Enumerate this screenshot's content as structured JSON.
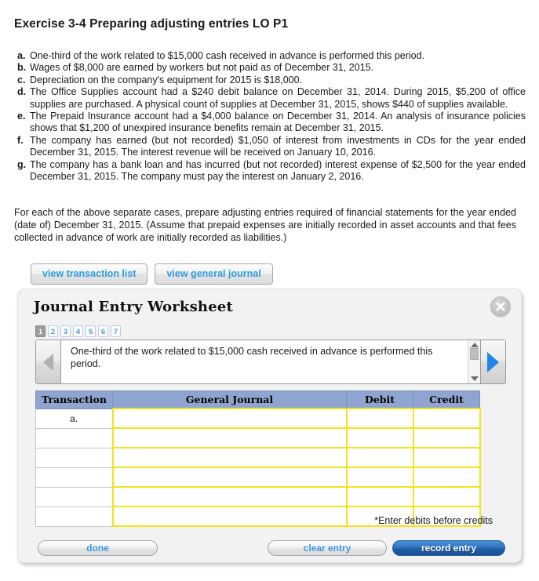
{
  "exercise": {
    "title": "Exercise 3-4 Preparing adjusting entries LO P1"
  },
  "problems": [
    {
      "letter": "a.",
      "text": "One-third of the work related to $15,000 cash received in advance is performed this period."
    },
    {
      "letter": "b.",
      "text": "Wages of $8,000 are earned by workers but not paid as of December 31, 2015."
    },
    {
      "letter": "c.",
      "text": "Depreciation on the company's equipment for 2015 is $18,000."
    },
    {
      "letter": "d.",
      "text": "The Office Supplies account had a $240 debit balance on December 31, 2014. During 2015, $5,200 of office supplies are purchased. A physical count of supplies at December 31, 2015, shows $440 of supplies available."
    },
    {
      "letter": "e.",
      "text": "The Prepaid Insurance account had a $4,000 balance on December 31, 2014. An analysis of insurance policies shows that $1,200 of unexpired insurance benefits remain at December 31, 2015."
    },
    {
      "letter": "f.",
      "text": "The company has earned (but not recorded) $1,050 of interest from investments in CDs for the year ended December 31, 2015. The interest revenue will be received on January 10, 2016."
    },
    {
      "letter": "g.",
      "text": "The company has a bank loan and has incurred (but not recorded) interest expense of $2,500 for the year ended December 31, 2015. The company must pay the interest on January 2, 2016."
    }
  ],
  "instructions": "For each of the above separate cases, prepare adjusting entries required of financial statements for the year ended (date of) December 31, 2015. (Assume that prepaid expenses are initially recorded in asset accounts and that fees collected in advance of work are initially recorded as liabilities.)",
  "view_buttons": [
    {
      "label": "view transaction list"
    },
    {
      "label": "view general journal"
    }
  ],
  "worksheet": {
    "title": "Journal Entry Worksheet",
    "close_label": "X",
    "steps": [
      {
        "label": "1",
        "active": true
      },
      {
        "label": "2",
        "active": false
      },
      {
        "label": "3",
        "active": false
      },
      {
        "label": "4",
        "active": false
      },
      {
        "label": "5",
        "active": false
      },
      {
        "label": "6",
        "active": false
      },
      {
        "label": "7",
        "active": false
      }
    ],
    "prompt": "One-third of the work related to $15,000 cash received in advance is performed this period.",
    "nav": {
      "prev_state": "disabled",
      "next_state": "enabled"
    },
    "table": {
      "headers": [
        "Transaction",
        "General Journal",
        "Debit",
        "Credit"
      ],
      "rows": [
        {
          "transaction": "a.",
          "general_journal": "",
          "debit": "",
          "credit": ""
        },
        {
          "transaction": "",
          "general_journal": "",
          "debit": "",
          "credit": ""
        },
        {
          "transaction": "",
          "general_journal": "",
          "debit": "",
          "credit": ""
        },
        {
          "transaction": "",
          "general_journal": "",
          "debit": "",
          "credit": ""
        },
        {
          "transaction": "",
          "general_journal": "",
          "debit": "",
          "credit": ""
        },
        {
          "transaction": "",
          "general_journal": "",
          "debit": "",
          "credit": ""
        }
      ]
    },
    "footnote": "*Enter debits before credits",
    "buttons": {
      "done": "done",
      "clear_entry": "clear entry",
      "record_entry": "record entry"
    }
  },
  "colors": {
    "link_blue": "#3d9ae2",
    "header_blue": "#8fa5cf",
    "input_border_yellow": "#f2e31c",
    "primary_button": "#2f73bf"
  }
}
